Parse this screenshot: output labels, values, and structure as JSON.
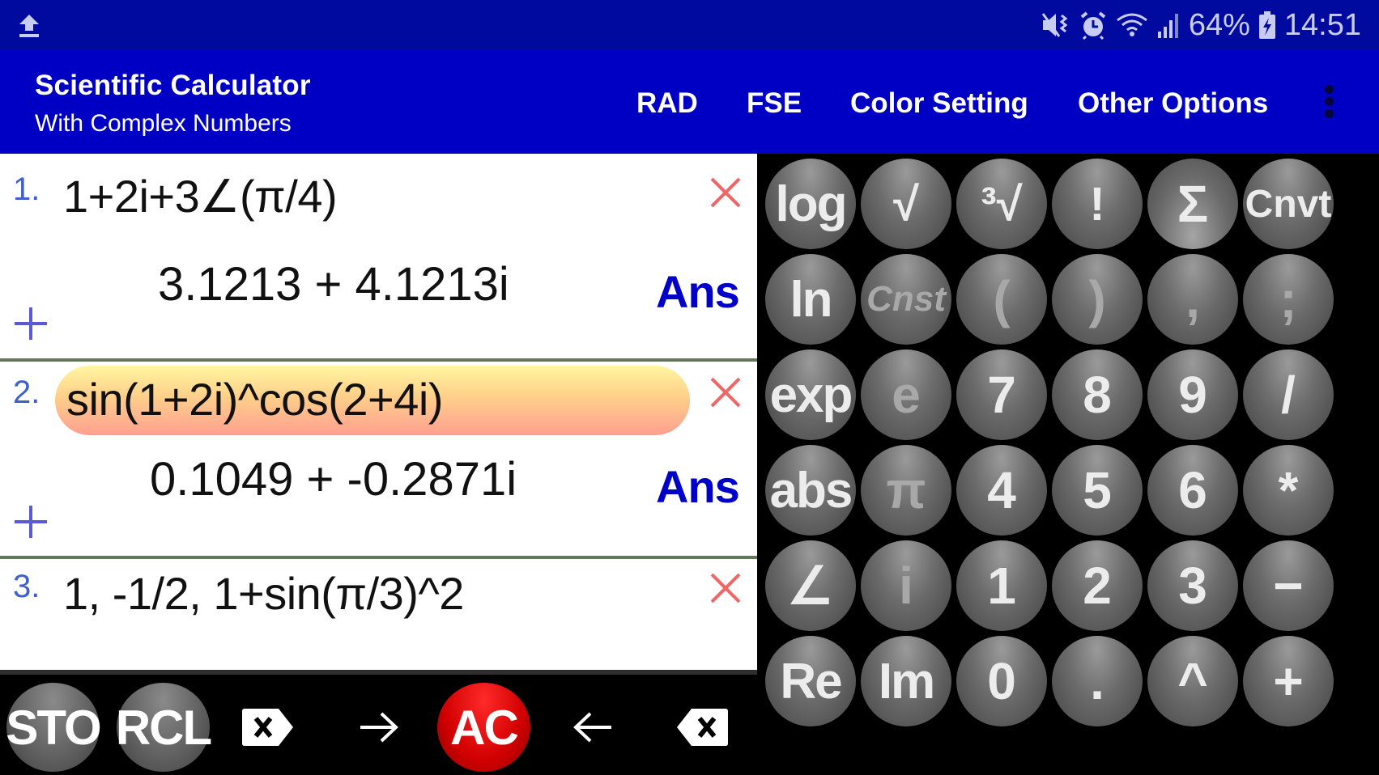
{
  "status_bar": {
    "left_icons": [
      "upload-icon"
    ],
    "right_icons": [
      "mute-vibrate-icon",
      "alarm-icon",
      "wifi-icon",
      "signal-icon"
    ],
    "battery_percent": "64%",
    "battery_icon": "battery-charging-icon",
    "time": "14:51"
  },
  "app_bar": {
    "title": "Scientific Calculator",
    "subtitle": "With Complex Numbers",
    "menu": [
      {
        "label": "RAD"
      },
      {
        "label": "FSE"
      },
      {
        "label": "Color Setting"
      },
      {
        "label": "Other Options"
      }
    ],
    "overflow_icon": "more-vert-icon"
  },
  "history": [
    {
      "index": "1.",
      "expression": "1+2i+3∠(π/4)",
      "result": "3.1213 + 4.1213i",
      "ans_label": "Ans",
      "highlighted": false
    },
    {
      "index": "2.",
      "expression": "sin(1+2i)^cos(2+4i)",
      "result": "0.1049 + -0.2871i",
      "ans_label": "Ans",
      "highlighted": true
    },
    {
      "index": "3.",
      "expression": "1, -1/2, 1+sin(π/3)^2",
      "result": "",
      "ans_label": "",
      "highlighted": false
    }
  ],
  "toolbar": {
    "sto": "STO",
    "rcl": "RCL",
    "ac": "AC",
    "icons": [
      "delete-forward-icon",
      "arrow-right-icon",
      "arrow-left-icon",
      "backspace-icon"
    ]
  },
  "keypad": {
    "rows": [
      [
        "log",
        "√",
        "³√",
        "!",
        "Σ",
        "Cnvt"
      ],
      [
        "ln",
        "Cnst",
        "(",
        ")",
        ",",
        ";"
      ],
      [
        "exp",
        "e",
        "7",
        "8",
        "9",
        "/"
      ],
      [
        "abs",
        "π",
        "4",
        "5",
        "6",
        "*"
      ],
      [
        "∠",
        "i",
        "1",
        "2",
        "3",
        "−"
      ],
      [
        "Re",
        "Im",
        "0",
        ".",
        "^",
        "+"
      ]
    ]
  },
  "colors": {
    "status_bar": "#000a9e",
    "app_bar": "#0000c4",
    "ans": "#0000c8",
    "delete": "#ee6666",
    "index": "#3f5fce",
    "ac_button": "#d10000"
  }
}
